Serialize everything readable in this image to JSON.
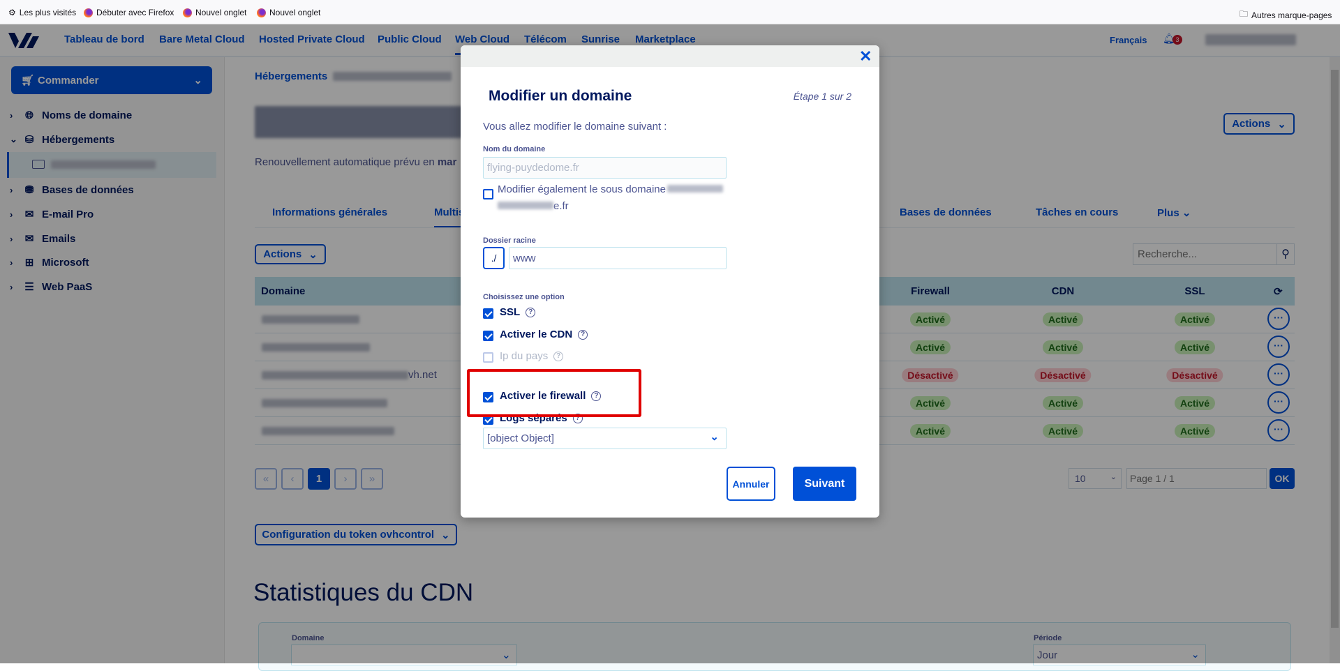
{
  "bookmarks": {
    "items": [
      "Les plus visités",
      "Débuter avec Firefox",
      "Nouvel onglet",
      "Nouvel onglet"
    ],
    "other": "Autres marque-pages"
  },
  "topnav": {
    "items": [
      "Tableau de bord",
      "Bare Metal Cloud",
      "Hosted Private Cloud",
      "Public Cloud",
      "Web Cloud",
      "Télécom",
      "Sunrise",
      "Marketplace"
    ],
    "active": "Web Cloud",
    "language": "Français",
    "notifications": "3"
  },
  "sidebar": {
    "order_button": "Commander",
    "items": [
      "Noms de domaine",
      "Hébergements",
      "Bases de données",
      "E-mail Pro",
      "Emails",
      "Microsoft",
      "Web PaaS"
    ]
  },
  "main": {
    "breadcrumb": "Hébergements",
    "renewal": "Renouvellement automatique prévu en",
    "renewal_bold": "mar",
    "actions": "Actions",
    "tabs": [
      "Informations générales",
      "Multis",
      "Bases de données",
      "Tâches en cours",
      "Plus"
    ],
    "table_actions": "Actions",
    "search_placeholder": "Recherche...",
    "columns": {
      "domain": "Domaine",
      "firewall": "Firewall",
      "cdn": "CDN",
      "ssl": "SSL"
    },
    "rows": [
      {
        "domain_suffix": "",
        "firewall": "Activé",
        "cdn": "Activé",
        "ssl": "Activé"
      },
      {
        "domain_suffix": "",
        "firewall": "Activé",
        "cdn": "Activé",
        "ssl": "Activé"
      },
      {
        "domain_suffix": "vh.net",
        "firewall": "Désactivé",
        "cdn": "Désactivé",
        "ssl": "Désactivé"
      },
      {
        "domain_suffix": "",
        "firewall": "Activé",
        "cdn": "Activé",
        "ssl": "Activé"
      },
      {
        "domain_suffix": "",
        "firewall": "Activé",
        "cdn": "Activé",
        "ssl": "Activé"
      }
    ],
    "pagination": {
      "first": "«",
      "prev": "‹",
      "current": "1",
      "next": "›",
      "last": "»",
      "per_page": "10",
      "page_placeholder": "Page 1 / 1",
      "ok": "OK"
    },
    "token_config": "Configuration du token ovhcontrol",
    "cdn_stats_title": "Statistiques du CDN",
    "stats": {
      "domain_label": "Domaine",
      "period_label": "Période",
      "period_value": "Jour"
    }
  },
  "modal": {
    "title": "Modifier un domaine",
    "step": "Étape 1 sur 2",
    "intro": "Vous allez modifier le domaine suivant :",
    "domain_label": "Nom du domaine",
    "domain_value": "flying-puydedome.fr",
    "subdomain_label": "Modifier également le sous domaine",
    "subdomain_suffix": "e.fr",
    "root_label": "Dossier racine",
    "root_prefix": "./",
    "root_value": "www",
    "options_label": "Choisissez une option",
    "options": [
      {
        "label": "SSL",
        "checked": true,
        "disabled": false
      },
      {
        "label": "Activer le CDN",
        "checked": true,
        "disabled": false
      },
      {
        "label": "Ip du pays",
        "checked": false,
        "disabled": true
      },
      {
        "label": "Activer le firewall",
        "checked": true,
        "disabled": false,
        "highlighted": true
      },
      {
        "label": "Logs séparés",
        "checked": true,
        "disabled": false
      }
    ],
    "logs_select": "[object Object]",
    "cancel": "Annuler",
    "next": "Suivant"
  },
  "colors": {
    "brand": "#0050d7",
    "highlight": "#e00000",
    "active_badge": "#c8f0b7",
    "inactive_badge": "#ffcfd4"
  }
}
